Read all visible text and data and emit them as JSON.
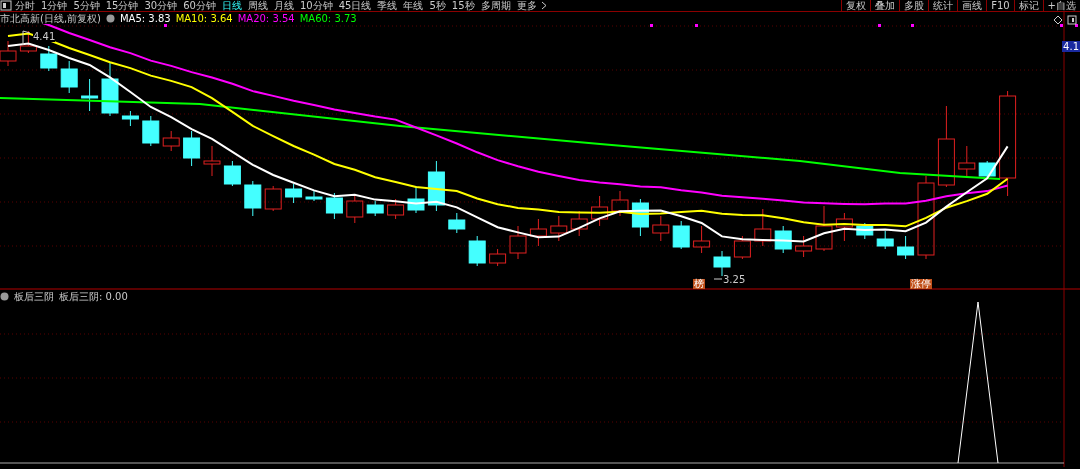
{
  "toolbar": {
    "tabs": [
      {
        "label": "分时",
        "selected": false
      },
      {
        "label": "1分钟",
        "selected": false
      },
      {
        "label": "5分钟",
        "selected": false
      },
      {
        "label": "15分钟",
        "selected": false
      },
      {
        "label": "30分钟",
        "selected": false
      },
      {
        "label": "60分钟",
        "selected": false
      },
      {
        "label": "日线",
        "selected": true
      },
      {
        "label": "周线",
        "selected": false
      },
      {
        "label": "月线",
        "selected": false
      },
      {
        "label": "10分钟",
        "selected": false
      },
      {
        "label": "45日线",
        "selected": false
      },
      {
        "label": "季线",
        "selected": false
      },
      {
        "label": "年线",
        "selected": false
      },
      {
        "label": "5秒",
        "selected": false
      },
      {
        "label": "15秒",
        "selected": false
      },
      {
        "label": "多周期",
        "selected": false
      },
      {
        "label": "更多",
        "selected": false
      }
    ],
    "tools": [
      "复权",
      "叠加",
      "多股",
      "统计",
      "画线",
      "F10",
      "标记",
      "+自选"
    ]
  },
  "chart": {
    "title": "市北高新(日线,前复权)",
    "ma": [
      {
        "label": "MA5: 3.83",
        "color": "#ffffff"
      },
      {
        "label": "MA10: 3.64",
        "color": "#ffff00"
      },
      {
        "label": "MA20: 3.54",
        "color": "#ff00ff"
      },
      {
        "label": "MA60: 3.73",
        "color": "#00ff00"
      }
    ],
    "high_label": "4.41",
    "low_label": "3.25",
    "price_tag": "4.1",
    "markers": [
      "榜",
      "涨停"
    ]
  },
  "indicator": {
    "title": "板后三阴",
    "value": "板后三阴: 0.00"
  }
}
